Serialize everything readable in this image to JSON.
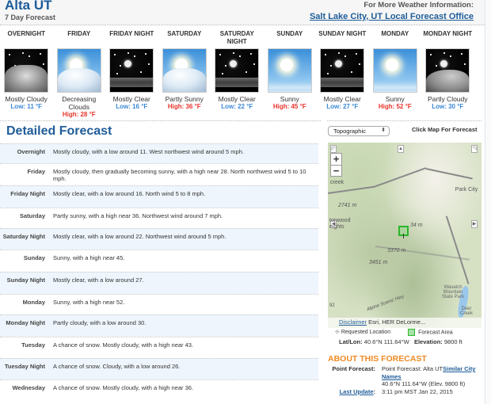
{
  "header": {
    "location_title": "Alta UT",
    "subtitle": "7 Day Forecast",
    "more_info_label": "For More Weather Information:",
    "office_link": "Salt Lake City, UT Local Forecast Office"
  },
  "periods": [
    {
      "name": "OVERNIGHT",
      "icon": "mostly-cloudy-night-icon",
      "desc": "Mostly Cloudy",
      "temp": "Low: 11 °F",
      "temp_type": "low"
    },
    {
      "name": "FRIDAY",
      "icon": "decreasing-clouds-icon",
      "desc": "Decreasing Clouds",
      "temp": "High: 28 °F",
      "temp_type": "high"
    },
    {
      "name": "FRIDAY NIGHT",
      "icon": "mostly-clear-night-icon",
      "desc": "Mostly Clear",
      "temp": "Low: 16 °F",
      "temp_type": "low"
    },
    {
      "name": "SATURDAY",
      "icon": "partly-sunny-icon",
      "desc": "Partly Sunny",
      "temp": "High: 36 °F",
      "temp_type": "high"
    },
    {
      "name": "SATURDAY NIGHT",
      "icon": "mostly-clear-night-icon",
      "desc": "Mostly Clear",
      "temp": "Low: 22 °F",
      "temp_type": "low"
    },
    {
      "name": "SUNDAY",
      "icon": "sunny-icon",
      "desc": "Sunny",
      "temp": "High: 45 °F",
      "temp_type": "high"
    },
    {
      "name": "SUNDAY NIGHT",
      "icon": "mostly-clear-night-icon",
      "desc": "Mostly Clear",
      "temp": "Low: 27 °F",
      "temp_type": "low"
    },
    {
      "name": "MONDAY",
      "icon": "sunny-icon",
      "desc": "Sunny",
      "temp": "High: 52 °F",
      "temp_type": "high"
    },
    {
      "name": "MONDAY NIGHT",
      "icon": "partly-cloudy-night-icon",
      "desc": "Partly Cloudy",
      "temp": "Low: 30 °F",
      "temp_type": "low"
    }
  ],
  "detailed": {
    "title": "Detailed Forecast",
    "rows": [
      {
        "label": "Overnight",
        "text": "Mostly cloudy, with a low around 11. West northwest wind around 5 mph."
      },
      {
        "label": "Friday",
        "text": "Mostly cloudy, then gradually becoming sunny, with a high near 28. North northwest wind 5 to 10 mph."
      },
      {
        "label": "Friday Night",
        "text": "Mostly clear, with a low around 16. North wind 5 to 8 mph."
      },
      {
        "label": "Saturday",
        "text": "Partly sunny, with a high near 36. Northwest wind around 7 mph."
      },
      {
        "label": "Saturday Night",
        "text": "Mostly clear, with a low around 22. Northwest wind around 5 mph."
      },
      {
        "label": "Sunday",
        "text": "Sunny, with a high near 45."
      },
      {
        "label": "Sunday Night",
        "text": "Mostly clear, with a low around 27."
      },
      {
        "label": "Monday",
        "text": "Sunny, with a high near 52."
      },
      {
        "label": "Monday Night",
        "text": "Partly cloudy, with a low around 30."
      },
      {
        "label": "Tuesday",
        "text": "A chance of snow. Mostly cloudy, with a high near 43."
      },
      {
        "label": "Tuesday Night",
        "text": "A chance of snow. Cloudy, with a low around 26."
      },
      {
        "label": "Wednesday",
        "text": "A chance of snow. Mostly cloudy, with a high near 36."
      }
    ]
  },
  "map": {
    "layer_select": "Topographic",
    "hint": "Click Map For Forecast",
    "zoom_in": "+",
    "zoom_out": "−",
    "labels": {
      "creek": "creek",
      "elev1": "2741 m",
      "cottonwood": "tonwood",
      "heights": "eights",
      "elev2": "34 m",
      "elev3": "3370 m",
      "elev4": "3451 m",
      "park_city": "Park City",
      "wasatch": "Wasatch Mountain State Park",
      "deer_creek": "Deer Creek",
      "route": "92",
      "scenic": "Alpine Scenic Hwy"
    },
    "disclaimer": "Disclaimer",
    "attribution": "Esri, HER",
    "attribution2": "DeLorme...",
    "legend_requested": "Requested Location",
    "legend_forecast_area": "Forecast Area",
    "latlon_label": "Lat/Lon:",
    "latlon_value": "40.6°N 111.64°W",
    "elevation_label": "Elevation:",
    "elevation_value": "9800 ft"
  },
  "about": {
    "title": "ABOUT THIS FORECAST",
    "point_label": "Point Forecast:",
    "point_value": "Point Forecast: Alta UT",
    "similar_link": "Similar City Names",
    "coords": "40.6°N 111.64°W (Elev. 9800 ft)",
    "update_label": "Last Update",
    "update_value": "3:11 pm MST Jan 22, 2015"
  },
  "colors": {
    "brand_blue": "#1f5c99",
    "low_temp": "#3b88d6",
    "high_temp": "#e8322b",
    "about_orange": "#f08a24",
    "forecast_area_green": "#2bb52b"
  }
}
